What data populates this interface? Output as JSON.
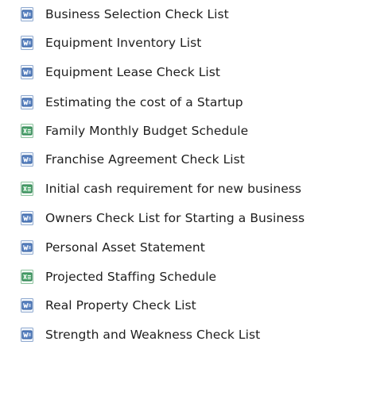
{
  "files": [
    {
      "name": "Business Selection Check List",
      "icon": "word-document-icon"
    },
    {
      "name": "Equipment Inventory List",
      "icon": "word-document-icon"
    },
    {
      "name": "Equipment Lease Check List",
      "icon": "word-document-icon"
    },
    {
      "name": "Estimating the cost of a Startup",
      "icon": "word-document-icon"
    },
    {
      "name": "Family Monthly Budget Schedule",
      "icon": "excel-spreadsheet-icon"
    },
    {
      "name": "Franchise Agreement Check List",
      "icon": "word-document-icon"
    },
    {
      "name": "Initial cash requirement for new business",
      "icon": "excel-spreadsheet-icon"
    },
    {
      "name": "Owners Check List for Starting a Business",
      "icon": "word-document-icon"
    },
    {
      "name": "Personal Asset Statement",
      "icon": "word-document-icon"
    },
    {
      "name": "Projected Staffing Schedule",
      "icon": "excel-spreadsheet-icon"
    },
    {
      "name": "Real Property Check List",
      "icon": "word-document-icon"
    },
    {
      "name": "Strength and Weakness Check List",
      "icon": "word-document-icon"
    }
  ],
  "colors": {
    "word": "#2b579a",
    "word_light": "#5a83c2",
    "excel": "#217346",
    "excel_light": "#4fa86f",
    "text": "#1e1e1e"
  }
}
